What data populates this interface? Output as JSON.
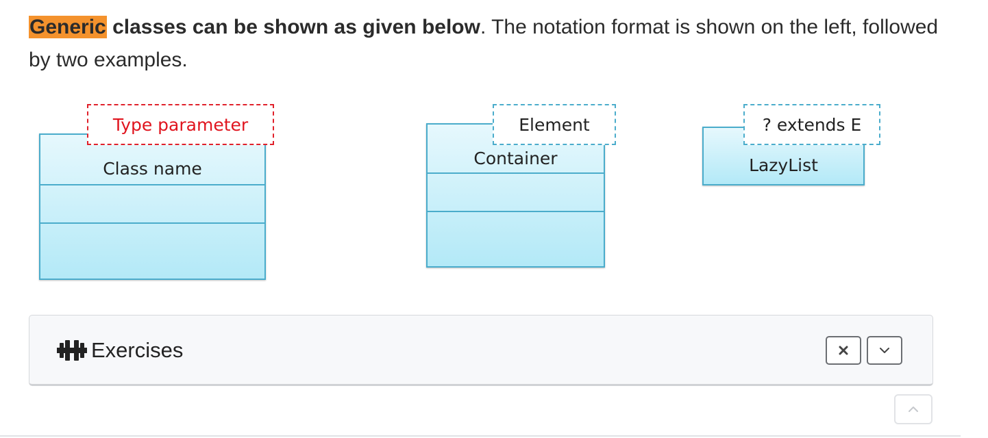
{
  "intro": {
    "highlight": "Generic",
    "bold_rest": " classes can be shown as given below",
    "plain": ". The notation format is shown on the left, followed by two examples."
  },
  "diagrams": {
    "format": {
      "type_parameter": "Type parameter",
      "class_name": "Class name"
    },
    "example1": {
      "type_parameter": "Element",
      "class_name": "Container"
    },
    "example2": {
      "type_parameter": "? extends E",
      "class_name": "LazyList"
    }
  },
  "exercises": {
    "title": "Exercises",
    "icon": "dumbbell-icon",
    "close_icon": "close-icon",
    "expand_icon": "chevron-down-icon"
  },
  "scroll_top_icon": "chevron-up-icon",
  "colors": {
    "highlight": "#f4922d",
    "type_param_red": "#e0141e",
    "box_border": "#4aaccb",
    "box_fill_top": "#e6f8fd",
    "box_fill_bottom": "#b3e9f7"
  }
}
